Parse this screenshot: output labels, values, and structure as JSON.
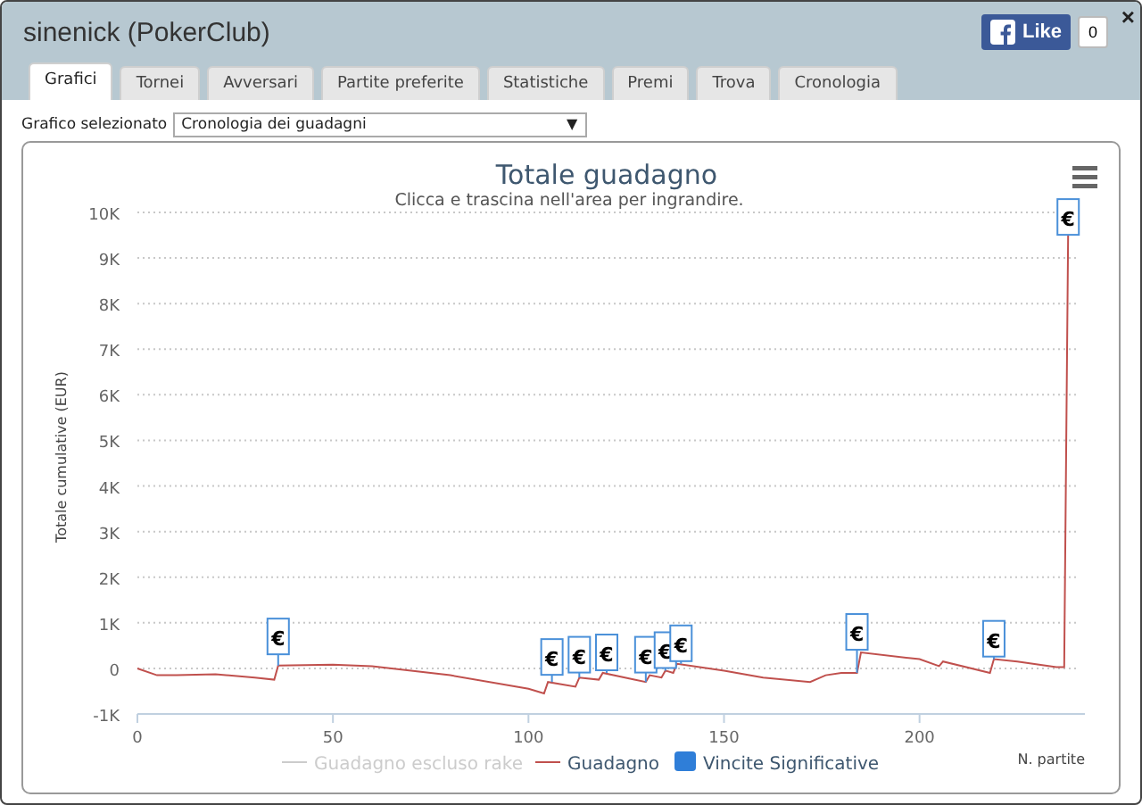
{
  "window": {
    "title": "sinenick (PokerClub)",
    "close": "×"
  },
  "like": {
    "label": "Like",
    "count": "0"
  },
  "tabs": [
    {
      "label": "Grafici",
      "selected": true
    },
    {
      "label": "Tornei",
      "selected": false
    },
    {
      "label": "Avversari",
      "selected": false
    },
    {
      "label": "Partite preferite",
      "selected": false
    },
    {
      "label": "Statistiche",
      "selected": false
    },
    {
      "label": "Premi",
      "selected": false
    },
    {
      "label": "Trova",
      "selected": false
    },
    {
      "label": "Cronologia",
      "selected": false
    }
  ],
  "chart_select": {
    "label": "Grafico selezionato",
    "value": "Cronologia dei guadagni",
    "caret": "▼"
  },
  "chart": {
    "subtitle": "Clicca e trascina nell'area per ingrandire.",
    "legend": [
      {
        "label": "Guadagno escluso rake",
        "kind": "line",
        "enabled": false
      },
      {
        "kind": "series",
        "enabled": true
      },
      {
        "label": "Vincite Significative",
        "kind": "flag",
        "enabled": true
      }
    ],
    "chart_data": {
      "type": "line",
      "title": "Totale guadagno",
      "xlabel": "N. partite",
      "ylabel": "Totale cumulative (EUR)",
      "x": [
        0,
        5,
        10,
        20,
        30,
        35,
        36,
        50,
        60,
        80,
        100,
        104,
        105,
        112,
        113,
        118,
        119,
        130,
        131,
        134,
        135,
        137,
        138,
        150,
        160,
        172,
        176,
        180,
        184,
        185,
        200,
        205,
        206,
        218,
        219,
        225,
        235,
        237,
        238
      ],
      "series": [
        {
          "name": "Guadagno",
          "color": "#c0504d",
          "values": [
            0,
            -150,
            -150,
            -130,
            -200,
            -250,
            60,
            80,
            50,
            -150,
            -450,
            -550,
            -300,
            -400,
            -200,
            -250,
            -100,
            -300,
            -150,
            -200,
            -50,
            -100,
            100,
            -50,
            -200,
            -300,
            -150,
            -100,
            -100,
            350,
            200,
            50,
            150,
            -100,
            200,
            150,
            30,
            30,
            9500
          ]
        }
      ],
      "xlim": [
        0,
        240
      ],
      "ylim": [
        -1000,
        10000
      ],
      "grid": true,
      "xticks": [
        0,
        50,
        100,
        150,
        200
      ],
      "yticks": [
        {
          "value": -1000,
          "label": "-1K"
        },
        {
          "value": 0,
          "label": "0"
        },
        {
          "value": 1000,
          "label": "1K"
        },
        {
          "value": 2000,
          "label": "2K"
        },
        {
          "value": 3000,
          "label": "3K"
        },
        {
          "value": 4000,
          "label": "4K"
        },
        {
          "value": 5000,
          "label": "5K"
        },
        {
          "value": 6000,
          "label": "6K"
        },
        {
          "value": 7000,
          "label": "7K"
        },
        {
          "value": 8000,
          "label": "8K"
        },
        {
          "value": 9000,
          "label": "9K"
        },
        {
          "value": 10000,
          "label": "10K"
        }
      ],
      "annotations": [
        {
          "x": 36,
          "y": 700,
          "text": "€"
        },
        {
          "x": 106,
          "y": 250,
          "text": "€"
        },
        {
          "x": 113,
          "y": 300,
          "text": "€"
        },
        {
          "x": 120,
          "y": 350,
          "text": "€"
        },
        {
          "x": 130,
          "y": 300,
          "text": "€"
        },
        {
          "x": 135,
          "y": 400,
          "text": "€"
        },
        {
          "x": 139,
          "y": 550,
          "text": "€"
        },
        {
          "x": 184,
          "y": 800,
          "text": "€"
        },
        {
          "x": 219,
          "y": 650,
          "text": "€"
        },
        {
          "x": 238,
          "y": 9900,
          "text": "€"
        }
      ]
    }
  }
}
